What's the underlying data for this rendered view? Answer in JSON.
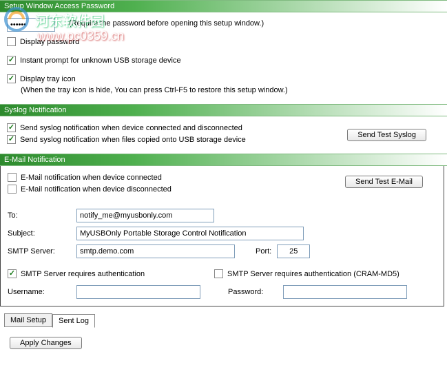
{
  "watermark": {
    "text": "河东软件园",
    "url": "www.pc0359.cn"
  },
  "section1": {
    "title": "Setup Window Access Password",
    "password_label": "xxxxxx",
    "password_hint": "(Require the password before opening this setup window.)",
    "display_password": {
      "label": "Display password",
      "checked": false
    },
    "instant_prompt": {
      "label": "Instant prompt for unknown USB storage device",
      "checked": true
    },
    "display_tray": {
      "label": "Display tray icon",
      "checked": true
    },
    "tray_hint": "(When the tray icon is hide, You can press Ctrl-F5 to restore this setup window.)"
  },
  "section2": {
    "title": "Syslog Notification",
    "connect": {
      "label": "Send syslog notification when device connected and disconnected",
      "checked": true
    },
    "copy": {
      "label": "Send syslog notification when files copied onto USB storage device",
      "checked": true
    },
    "test_btn": "Send Test Syslog"
  },
  "section3": {
    "title": "E-Mail Notification",
    "on_connect": {
      "label": "E-Mail notification when device connected",
      "checked": false
    },
    "on_disconnect": {
      "label": "E-Mail notification when device disconnected",
      "checked": false
    },
    "test_btn": "Send Test E-Mail",
    "to_label": "To:",
    "to_value": "notify_me@myusbonly.com",
    "subject_label": "Subject:",
    "subject_value": "MyUSBOnly Portable Storage Control Notification",
    "smtp_label": "SMTP Server:",
    "smtp_value": "smtp.demo.com",
    "port_label": "Port:",
    "port_value": "25",
    "auth1": {
      "label": "SMTP Server requires authentication",
      "checked": true
    },
    "auth2": {
      "label": "SMTP Server requires authentication (CRAM-MD5)",
      "checked": false
    },
    "user_label": "Username:",
    "user_value": "",
    "pass_label": "Password:",
    "pass_value": ""
  },
  "tabs": {
    "mail_setup": "Mail Setup",
    "sent_log": "Sent Log"
  },
  "apply": "Apply Changes"
}
